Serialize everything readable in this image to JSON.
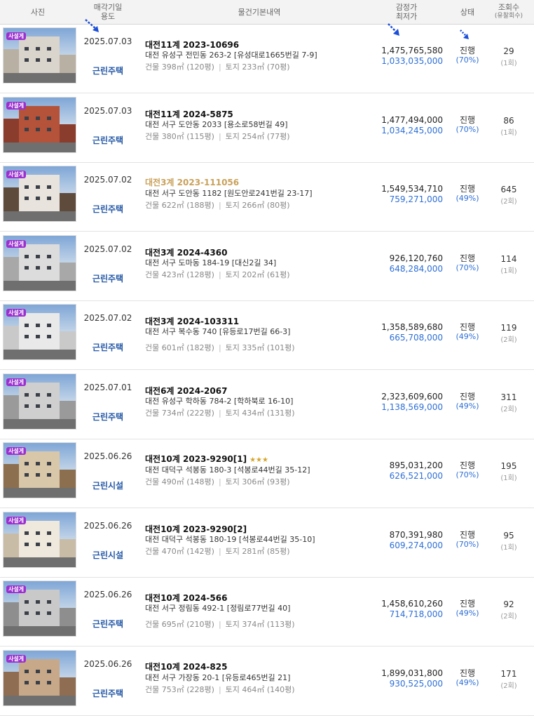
{
  "header": {
    "photo": "사진",
    "date_line1": "매각기일",
    "date_line2": "용도",
    "info": "물건기본내역",
    "price_line1": "감정가",
    "price_line2": "최저가",
    "status": "상태",
    "views_line1": "조회수",
    "views_line2": "(유찰회수)"
  },
  "badge_label": "사설게",
  "colors": {
    "accent_blue": "#2e6fd6",
    "badge_purple": "#9b2fcf",
    "gold_title": "#c9a15a"
  },
  "rows": [
    {
      "date": "2025.07.03",
      "usage": "근린주택",
      "title": "대전11계 2023-10696",
      "addr": "대전 유성구 전민동 263-2 [유성대로1665번길 7-9]",
      "building": "건물 398㎡ (120평)",
      "land": "토지 233㎡ (70평)",
      "appraisal": "1,475,765,580",
      "minimum": "1,033,035,000",
      "status": "진행",
      "pct": "(70%)",
      "views": "29",
      "fails": "(1회)",
      "badge": true
    },
    {
      "date": "2025.07.03",
      "usage": "근린주택",
      "title": "대전11계 2024-5875",
      "addr": "대전 서구 도안동 2033 [용소로58번길 49]",
      "building": "건물 380㎡ (115평)",
      "land": "토지 254㎡ (77평)",
      "appraisal": "1,477,494,000",
      "minimum": "1,034,245,000",
      "status": "진행",
      "pct": "(70%)",
      "views": "86",
      "fails": "(1회)",
      "badge": true
    },
    {
      "date": "2025.07.02",
      "usage": "근린주택",
      "title": "대전3계 2023-111056",
      "addr": "대전 서구 도안동 1182 [원도안로241번길 23-17]",
      "building": "건물 622㎡ (188평)",
      "land": "토지 266㎡ (80평)",
      "appraisal": "1,549,534,710",
      "minimum": "759,271,000",
      "status": "진행",
      "pct": "(49%)",
      "views": "645",
      "fails": "(2회)",
      "badge": true
    },
    {
      "date": "2025.07.02",
      "usage": "근린주택",
      "title": "대전3계 2024-4360",
      "addr": "대전 서구 도마동 184-19 [대신2길 34]",
      "building": "건물 423㎡ (128평)",
      "land": "토지 202㎡ (61평)",
      "appraisal": "926,120,760",
      "minimum": "648,284,000",
      "status": "진행",
      "pct": "(70%)",
      "views": "114",
      "fails": "(1회)",
      "badge": true
    },
    {
      "date": "2025.07.02",
      "usage": "근린주택",
      "title": "대전3계 2024-103311",
      "addr": "대전 서구 복수동 740 [유등로17번길 66-3]",
      "building": "건물 601㎡ (182평)",
      "land": "토지 335㎡ (101평)",
      "appraisal": "1,358,589,680",
      "minimum": "665,708,000",
      "status": "진행",
      "pct": "(49%)",
      "views": "119",
      "fails": "(2회)",
      "badge": true
    },
    {
      "date": "2025.07.01",
      "usage": "근린주택",
      "title": "대전6계 2024-2067",
      "addr": "대전 유성구 학하동 784-2 [학하북로 16-10]",
      "building": "건물 734㎡ (222평)",
      "land": "토지 434㎡ (131평)",
      "appraisal": "2,323,609,600",
      "minimum": "1,138,569,000",
      "status": "진행",
      "pct": "(49%)",
      "views": "311",
      "fails": "(2회)",
      "badge": true
    },
    {
      "date": "2025.06.26",
      "usage": "근린시설",
      "title": "대전10계 2023-9290[1]",
      "addr": "대전 대덕구 석봉동 180-3 [석봉로44번길 35-12]",
      "building": "건물 490㎡ (148평)",
      "land": "토지 306㎡ (93평)",
      "appraisal": "895,031,200",
      "minimum": "626,521,000",
      "status": "진행",
      "pct": "(70%)",
      "views": "195",
      "fails": "(1회)",
      "badge": true,
      "stars": "★★★"
    },
    {
      "date": "2025.06.26",
      "usage": "근린시설",
      "title": "대전10계 2023-9290[2]",
      "addr": "대전 대덕구 석봉동 180-19 [석봉로44번길 35-10]",
      "building": "건물 470㎡ (142평)",
      "land": "토지 281㎡ (85평)",
      "appraisal": "870,391,980",
      "minimum": "609,274,000",
      "status": "진행",
      "pct": "(70%)",
      "views": "95",
      "fails": "(1회)",
      "badge": true
    },
    {
      "date": "2025.06.26",
      "usage": "근린주택",
      "title": "대전10계 2024-566",
      "addr": "대전 서구 정림동 492-1 [정림로77번길 40]",
      "building": "건물 695㎡ (210평)",
      "land": "토지 374㎡ (113평)",
      "appraisal": "1,458,610,260",
      "minimum": "714,718,000",
      "status": "진행",
      "pct": "(49%)",
      "views": "92",
      "fails": "(2회)",
      "badge": true
    },
    {
      "date": "2025.06.26",
      "usage": "근린주택",
      "title": "대전10계 2024-825",
      "addr": "대전 서구 가장동 20-1 [유등로465번길 21]",
      "building": "건물 753㎡ (228평)",
      "land": "토지 464㎡ (140평)",
      "appraisal": "1,899,031,800",
      "minimum": "930,525,000",
      "status": "진행",
      "pct": "(49%)",
      "views": "171",
      "fails": "(2회)",
      "badge": true
    }
  ]
}
